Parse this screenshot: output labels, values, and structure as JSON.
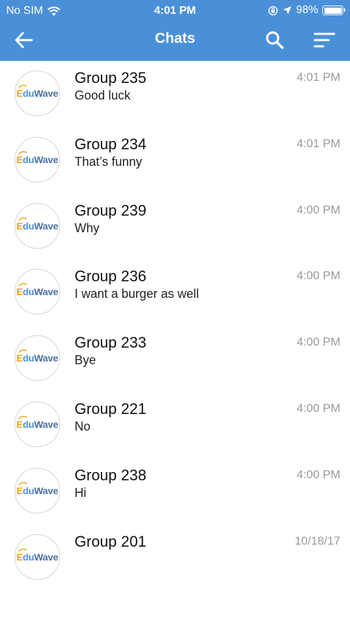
{
  "status_bar": {
    "carrier": "No SIM",
    "time": "4:01 PM",
    "battery": "98%"
  },
  "header": {
    "title": "Chats"
  },
  "logo": {
    "e": "E",
    "du": "du",
    "wave": "Wave"
  },
  "chats": [
    {
      "name": "Group 235",
      "last_message": "Good luck",
      "time": "4:01 PM"
    },
    {
      "name": "Group 234",
      "last_message": "That’s funny",
      "time": "4:01 PM"
    },
    {
      "name": "Group 239",
      "last_message": "Why",
      "time": "4:00 PM"
    },
    {
      "name": "Group 236",
      "last_message": "I want a burger as well",
      "time": "4:00 PM"
    },
    {
      "name": "Group 233",
      "last_message": "Bye",
      "time": "4:00 PM"
    },
    {
      "name": "Group 221",
      "last_message": "No",
      "time": "4:00 PM"
    },
    {
      "name": "Group 238",
      "last_message": "Hi",
      "time": "4:00 PM"
    },
    {
      "name": "Group 201",
      "last_message": "",
      "time": "10/18/17"
    }
  ],
  "colors": {
    "header_bg": "#4a90d9",
    "logo_orange": "#f0a020",
    "logo_blue": "#4a90d9"
  },
  "icons": {
    "back": "arrow-left-icon",
    "search": "search-icon",
    "sort": "sort-icon",
    "wifi": "wifi-icon",
    "location": "location-arrow-icon",
    "lock_rotation": "rotation-lock-icon",
    "battery": "battery-icon"
  }
}
